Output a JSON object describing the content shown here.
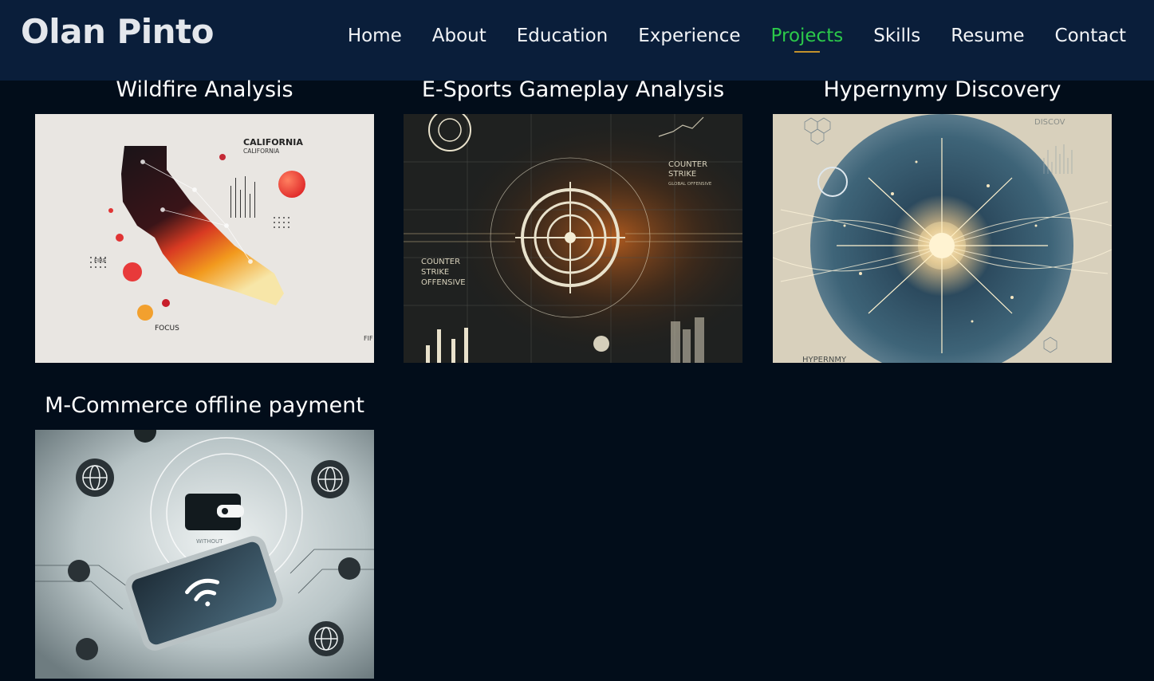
{
  "brand": "Olan Pinto",
  "nav": [
    {
      "label": "Home",
      "active": false
    },
    {
      "label": "About",
      "active": false
    },
    {
      "label": "Education",
      "active": false
    },
    {
      "label": "Experience",
      "active": false
    },
    {
      "label": "Projects",
      "active": true
    },
    {
      "label": "Skills",
      "active": false
    },
    {
      "label": "Resume",
      "active": false
    },
    {
      "label": "Contact",
      "active": false
    }
  ],
  "colors": {
    "page_background": "#020d1a",
    "navbar_background": "#0a1e3a",
    "active_link": "#2cc94a",
    "active_underline": "#c2912c"
  },
  "projects": [
    {
      "title": "Wildfire Analysis",
      "image": {
        "icon": "california-wildfire-map-illustration",
        "labels": {
          "heading": "CALIFORNIA",
          "subheading": "CALIFORNIA",
          "left": "FIRE",
          "bottom": "FOCUS",
          "corner": "FIF"
        }
      }
    },
    {
      "title": "E-Sports Gameplay Analysis",
      "image": {
        "icon": "target-crosshair-illustration",
        "labels": {
          "right_1": "COUNTER",
          "right_2": "STRIKE",
          "right_3": "GLOBAL OFFENSIVE",
          "left_1": "COUNTER",
          "left_2": "STRIKE",
          "left_3": "OFFENSIVE"
        }
      }
    },
    {
      "title": "Hypernymy Discovery",
      "image": {
        "icon": "network-burst-illustration",
        "labels": {
          "top_right": "DISCOV",
          "bottom_left": "HYPERNMY"
        }
      }
    },
    {
      "title": "M-Commerce offline payment",
      "image": {
        "icon": "smartphone-wallet-illustration",
        "labels": {
          "wallet_caption": "WITHOUT"
        }
      }
    }
  ]
}
